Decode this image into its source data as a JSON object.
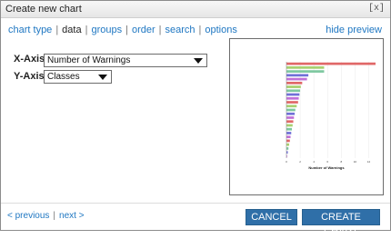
{
  "dialog": {
    "title": "Create new chart",
    "close_label": "[x]"
  },
  "nav": {
    "items": [
      {
        "label": "chart type",
        "active": false
      },
      {
        "label": "data",
        "active": true
      },
      {
        "label": "groups",
        "active": false
      },
      {
        "label": "order",
        "active": false
      },
      {
        "label": "search",
        "active": false
      },
      {
        "label": "options",
        "active": false
      }
    ],
    "separator": "|",
    "hide_preview": "hide preview"
  },
  "form": {
    "x_axis_label": "X-Axis:",
    "x_axis_value": "Number of Warnings",
    "y_axis_label": "Y-Axis:",
    "y_axis_value": "Classes"
  },
  "chart_data": {
    "type": "bar",
    "orientation": "horizontal",
    "xlabel": "Number of Warnings",
    "categories": [
      "",
      "",
      "",
      "",
      "",
      "",
      "",
      "",
      "",
      "",
      "",
      "",
      "",
      "",
      "",
      "",
      "",
      "",
      "",
      "",
      "",
      "",
      "",
      "",
      ""
    ],
    "values": [
      13,
      5.5,
      5.5,
      3.2,
      3,
      2.3,
      2.1,
      2,
      1.9,
      1.8,
      1.7,
      1.5,
      1.3,
      1.2,
      1.1,
      1,
      0.9,
      0.8,
      0.7,
      0.6,
      0.5,
      0.4,
      0.3,
      0.2,
      0.1
    ],
    "colors": [
      "#e06868",
      "#a8d070",
      "#7ec8a0",
      "#7070d8",
      "#c070d8",
      "#e06868",
      "#a8d070",
      "#7ec8a0",
      "#7070d8",
      "#c070d8",
      "#e06868",
      "#a8d070",
      "#7ec8a0",
      "#7070d8",
      "#c070d8",
      "#e06868",
      "#a8d070",
      "#7ec8a0",
      "#7070d8",
      "#c070d8",
      "#e06868",
      "#a8d070",
      "#7ec8a0",
      "#7070d8",
      "#c070d8"
    ],
    "xlim": [
      0,
      13
    ],
    "grid": true
  },
  "footer": {
    "previous": "< previous",
    "next": "next >",
    "separator": "|",
    "cancel": "CANCEL",
    "create": "CREATE CHART"
  }
}
